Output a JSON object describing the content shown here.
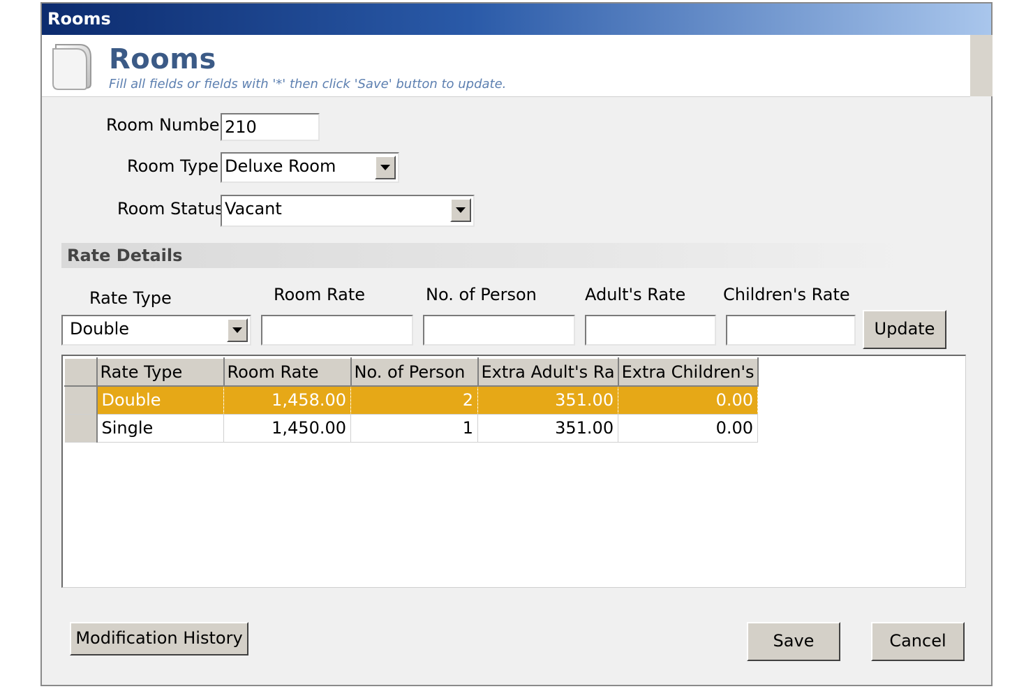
{
  "window": {
    "title": "Rooms"
  },
  "header": {
    "title": "Rooms",
    "subtitle": "Fill all fields or fields with '*' then click 'Save' button to update."
  },
  "form": {
    "room_number_label": "Room Number",
    "room_number_value": "210",
    "room_type_label": "Room Type",
    "room_type_value": "Deluxe Room",
    "room_status_label": "Room Status",
    "room_status_value": "Vacant"
  },
  "rate_details": {
    "section_title": "Rate Details",
    "rate_type_label": "Rate Type",
    "rate_type_value": "Double",
    "room_rate_label": "Room Rate",
    "no_of_person_label": "No. of Person",
    "adults_rate_label": "Adult's Rate",
    "childrens_rate_label": "Children's Rate",
    "update_label": "Update"
  },
  "grid": {
    "columns": [
      "Rate Type",
      "Room Rate",
      "No. of Person",
      "Extra Adult's Ra",
      "Extra Children's"
    ],
    "rows": [
      {
        "rate_type": "Double",
        "room_rate": "1,458.00",
        "no_of_person": "2",
        "extra_adult": "351.00",
        "extra_children": "0.00",
        "selected": true
      },
      {
        "rate_type": "Single",
        "room_rate": "1,450.00",
        "no_of_person": "1",
        "extra_adult": "351.00",
        "extra_children": "0.00",
        "selected": false
      }
    ],
    "selected_row_color": "#e6a817"
  },
  "footer": {
    "modification_history_label": "Modification History",
    "save_label": "Save",
    "cancel_label": "Cancel"
  },
  "colors": {
    "titlebar_dark": "#0c2b6e",
    "titlebar_light": "#a9c6ec",
    "header_title": "#3b5a86"
  }
}
